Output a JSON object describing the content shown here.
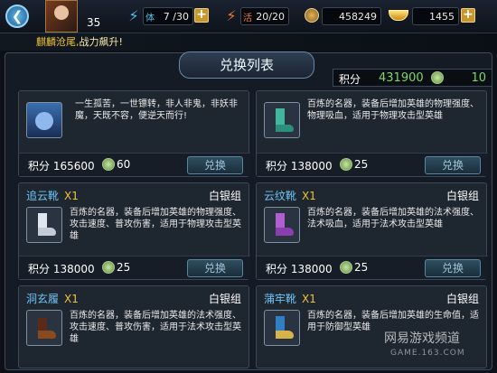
{
  "header": {
    "level": "35",
    "stamina": {
      "icon": "lightning-stamina-icon",
      "label": "体",
      "value": "7 /30"
    },
    "energy": {
      "icon": "lightning-energy-icon",
      "label": "活",
      "value": "20/20"
    },
    "coins": {
      "icon": "copper-coin-icon",
      "value": "458249"
    },
    "ingots": {
      "icon": "gold-ingot-icon",
      "value": "1455"
    }
  },
  "notice": {
    "highlight": "麒麟沧尾,",
    "text": "战力飙升!"
  },
  "panel": {
    "title": "兑换列表",
    "score_label": "积分",
    "score_value": "431900",
    "jade_value": "10"
  },
  "items": [
    {
      "name": "",
      "qty": "",
      "group": "",
      "desc": "一生孤苦，一世镖转，非人非鬼，非妖非魔，天既不容，便逆天而行!",
      "cost_label": "积分",
      "cost": "165600",
      "jade": "60",
      "button": "兑换",
      "icon": "blue-hair-hero-portrait"
    },
    {
      "name": "",
      "qty": "",
      "group": "",
      "desc": "百炼的名器，装备后增加英雄的物理强度、物理吸血，适用于物理攻击型英雄",
      "cost_label": "积分",
      "cost": "138000",
      "jade": "25",
      "button": "兑换",
      "icon": "green-boots-icon"
    },
    {
      "name": "追云靴",
      "qty": "X1",
      "group": "白银组",
      "desc": "百炼的名器，装备后增加英雄的物理强度、攻击速度、普攻伤害，适用于物理攻击型英雄",
      "cost_label": "积分",
      "cost": "138000",
      "jade": "25",
      "button": "兑换",
      "icon": "white-boots-icon"
    },
    {
      "name": "云纹靴",
      "qty": "X1",
      "group": "白银组",
      "desc": "百炼的名器，装备后增加英雄的法术强度、法术吸血，适用于法术攻击型英雄",
      "cost_label": "积分",
      "cost": "138000",
      "jade": "25",
      "button": "兑换",
      "icon": "purple-boots-icon"
    },
    {
      "name": "洞玄履",
      "qty": "X1",
      "group": "白银组",
      "desc": "百炼的名器，装备后增加英雄的法术强度、攻击速度、普攻伤害，适用于法术攻击型英雄",
      "icon": "dark-shoes-icon"
    },
    {
      "name": "蒲牢靴",
      "qty": "X1",
      "group": "白银组",
      "desc": "百炼的名器，装备后增加英雄的生命值，适用于防御型英雄",
      "icon": "blue-gold-boots-icon"
    }
  ],
  "watermark": {
    "line1": "网易游戏频道",
    "line2": "GAME.163.COM"
  },
  "colors": {
    "accent": "#6fc3f5",
    "gold": "#f0c23a",
    "green": "#7bd66b"
  }
}
